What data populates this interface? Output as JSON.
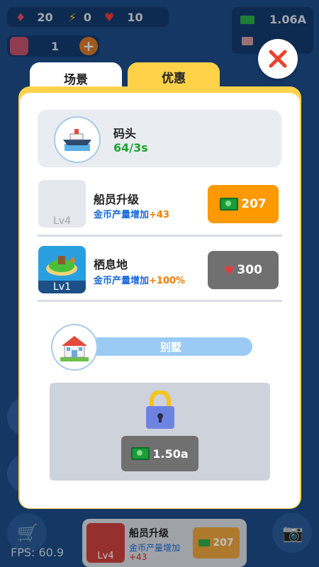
{
  "hud": {
    "gems": "20",
    "bolts": "0",
    "hearts": "10",
    "workers": "1",
    "cash_total": "1.06A"
  },
  "tabs": [
    {
      "label": "场景",
      "active": true
    },
    {
      "label": "优惠",
      "active": false
    }
  ],
  "dock": {
    "name": "码头",
    "rate": "64/3s"
  },
  "upgrades": [
    {
      "title": "船员升级",
      "sub": "金币产量增加",
      "plus": "+43",
      "level": "Lv4",
      "price": "207",
      "currency": "cash-icon",
      "button_color": "#ff9900"
    },
    {
      "title": "栖息地",
      "sub": "金币产量增加",
      "plus": "+100%",
      "level": "Lv1",
      "price": "300",
      "currency": "heart-icon",
      "button_color": "#707070"
    }
  ],
  "next_scene": {
    "name": "别墅",
    "unlock_price": "1.50a"
  },
  "bottom_bar": {
    "title": "船员升级",
    "sub": "金币产量增加",
    "plus": "+43",
    "level": "Lv4",
    "price": "207"
  },
  "fps": "FPS: 60.9",
  "colors": {
    "background": "#1b4a86",
    "panel": "#ffd24a",
    "accent_orange": "#ff9900",
    "close_x": "#e8442c",
    "rate_green": "#1aa42e"
  }
}
